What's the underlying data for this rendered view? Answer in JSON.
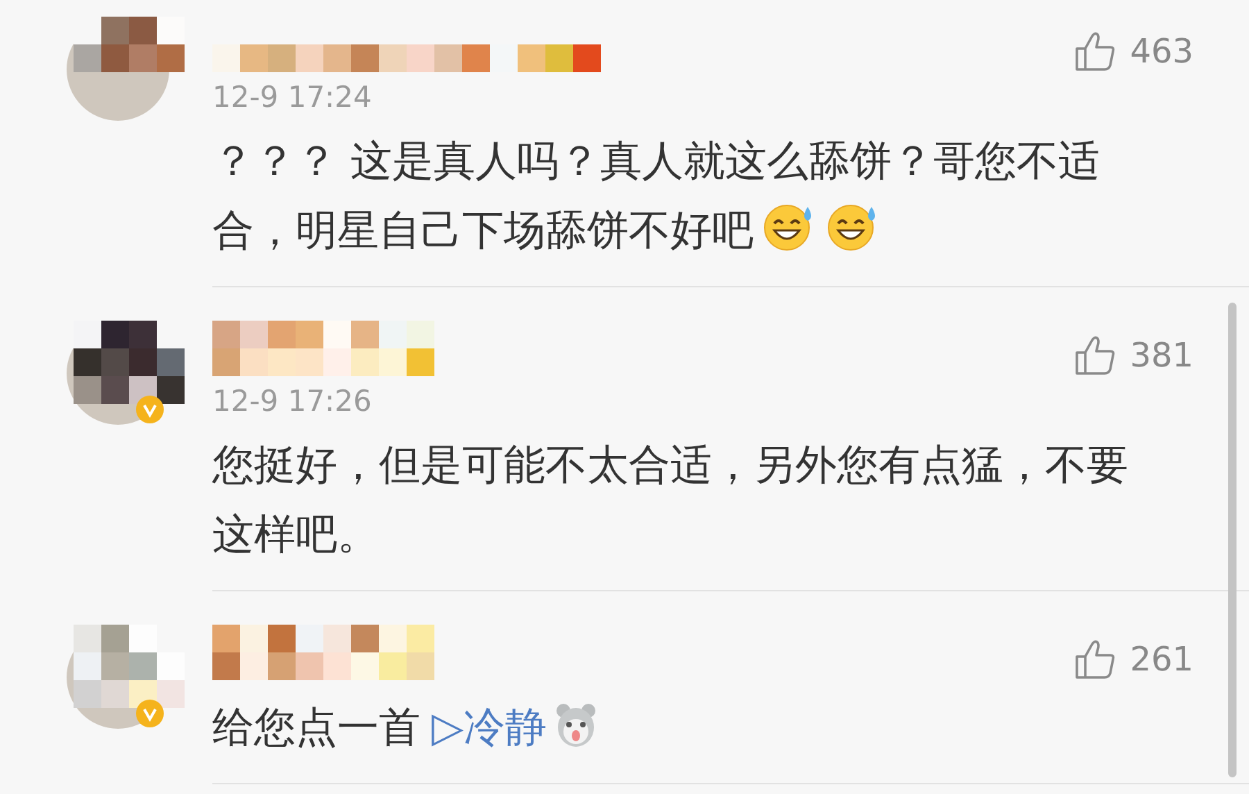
{
  "comments": [
    {
      "time": "12-9 17:24",
      "likes": "463",
      "verified": false,
      "parts": [
        {
          "kind": "text",
          "text": "？？？ 这是真人吗？真人就这么舔饼？哥您不适合，明星自己下场舔饼不好吧"
        },
        {
          "kind": "emoji"
        },
        {
          "kind": "emoji"
        }
      ]
    },
    {
      "time": "12-9 17:26",
      "likes": "381",
      "verified": true,
      "parts": [
        {
          "kind": "text",
          "text": "您挺好，但是可能不太合适，另外您有点猛，不要这样吧。"
        }
      ]
    },
    {
      "likes": "261",
      "verified": true,
      "parts": [
        {
          "kind": "text",
          "text": "给您点一首"
        },
        {
          "kind": "link",
          "text": "▷冷静"
        },
        {
          "kind": "sticker"
        }
      ]
    }
  ]
}
